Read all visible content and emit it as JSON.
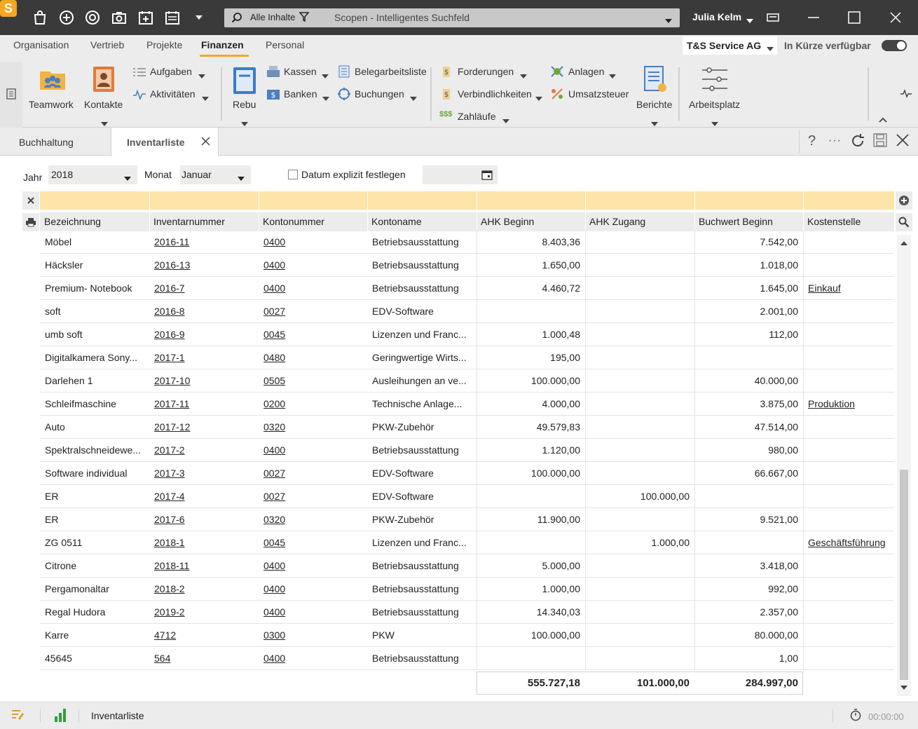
{
  "titlebar": {
    "search_scope": "Alle Inhalte",
    "search_placeholder": "Scopen - Intelligentes Suchfeld",
    "user": "Julia Kelm"
  },
  "menu": [
    "Organisation",
    "Vertrieb",
    "Projekte",
    "Finanzen",
    "Personal"
  ],
  "menu_active": "Finanzen",
  "company": "T&S Service AG",
  "availability_label": "In Kürze verfügbar",
  "ribbon": {
    "teamwork": "Teamwork",
    "kontakte": "Kontakte",
    "aufgaben": "Aufgaben",
    "aktivitaeten": "Aktivitäten",
    "rebu": "Rebu",
    "kassen": "Kassen",
    "banken": "Banken",
    "belegarbeitsliste": "Belegarbeitsliste",
    "buchungen": "Buchungen",
    "forderungen": "Forderungen",
    "verbindlichkeiten": "Verbindlichkeiten",
    "zahllaeufe": "Zahläufe",
    "anlagen": "Anlagen",
    "umsatzsteuer": "Umsatzsteuer",
    "berichte": "Berichte",
    "arbeitsplatz": "Arbeitsplatz"
  },
  "tabs": [
    {
      "label": "Buchhaltung",
      "active": false
    },
    {
      "label": "Inventarliste",
      "active": true
    }
  ],
  "filters": {
    "jahr_label": "Jahr",
    "jahr_value": "2018",
    "monat_label": "Monat",
    "monat_value": "Januar",
    "datum_label": "Datum explizit festlegen",
    "datum_checked": false
  },
  "columns": [
    "Bezeichnung",
    "Inventarnummer",
    "Kontonummer",
    "Kontoname",
    "AHK Beginn",
    "AHK Zugang",
    "Buchwert Beginn",
    "Kostenstelle"
  ],
  "rows": [
    [
      "Möbel",
      "2016-11",
      "0400",
      "Betriebsausstattung",
      "8.403,36",
      "",
      "7.542,00",
      ""
    ],
    [
      "Häcksler",
      "2016-13",
      "0400",
      "Betriebsausstattung",
      "1.650,00",
      "",
      "1.018,00",
      ""
    ],
    [
      "Premium-  Notebook",
      "2016-7",
      "0400",
      "Betriebsausstattung",
      "4.460,72",
      "",
      "1.645,00",
      "Einkauf"
    ],
    [
      "soft",
      "2016-8",
      "0027",
      "EDV-Software",
      "",
      "",
      "2.001,00",
      ""
    ],
    [
      "umb soft",
      "2016-9",
      "0045",
      "Lizenzen und Franc...",
      "1.000,48",
      "",
      "112,00",
      ""
    ],
    [
      "Digitalkamera Sony...",
      "2017-1",
      "0480",
      "Geringwertige Wirts...",
      "195,00",
      "",
      "",
      ""
    ],
    [
      "Darlehen 1",
      "2017-10",
      "0505",
      "Ausleihungen an ve...",
      "100.000,00",
      "",
      "40.000,00",
      ""
    ],
    [
      "Schleifmaschine",
      "2017-11",
      "0200",
      "Technische Anlage...",
      "4.000,00",
      "",
      "3.875,00",
      "Produktion"
    ],
    [
      "Auto",
      "2017-12",
      "0320",
      "PKW-Zubehör",
      "49.579,83",
      "",
      "47.514,00",
      ""
    ],
    [
      "Spektralschneidewe...",
      "2017-2",
      "0400",
      "Betriebsausstattung",
      "1.120,00",
      "",
      "980,00",
      ""
    ],
    [
      "Software individual",
      "2017-3",
      "0027",
      "EDV-Software",
      "100.000,00",
      "",
      "66.667,00",
      ""
    ],
    [
      "ER",
      "2017-4",
      "0027",
      "EDV-Software",
      "",
      "100.000,00",
      "",
      ""
    ],
    [
      "ER",
      "2017-6",
      "0320",
      "PKW-Zubehör",
      "11.900,00",
      "",
      "9.521,00",
      ""
    ],
    [
      "ZG 0511",
      "2018-1",
      "0045",
      "Lizenzen und Franc...",
      "",
      "1.000,00",
      "",
      "Geschäftsführung"
    ],
    [
      "Citrone",
      "2018-11",
      "0400",
      "Betriebsausstattung",
      "5.000,00",
      "",
      "3.418,00",
      ""
    ],
    [
      "Pergamonaltar",
      "2018-2",
      "0400",
      "Betriebsausstattung",
      "1.000,00",
      "",
      "992,00",
      ""
    ],
    [
      "Regal Hudora",
      "2019-2",
      "0400",
      "Betriebsausstattung",
      "14.340,03",
      "",
      "2.357,00",
      ""
    ],
    [
      "Karre",
      "4712",
      "0300",
      "PKW",
      "100.000,00",
      "",
      "80.000,00",
      ""
    ],
    [
      "45645",
      "564",
      "0400",
      "Betriebsausstattung",
      "",
      "",
      "1,00",
      ""
    ]
  ],
  "totals": {
    "ahk_beginn": "555.727,18",
    "ahk_zugang": "101.000,00",
    "buchwert_beginn": "284.997,00"
  },
  "statusbar": {
    "label": "Inventarliste",
    "timer": "00:00:00"
  },
  "colors": {
    "accent": "#f5a623",
    "filter_row": "#fde4a8",
    "titlebar": "#3a3a3a",
    "ribbon_bg": "#ececec"
  }
}
